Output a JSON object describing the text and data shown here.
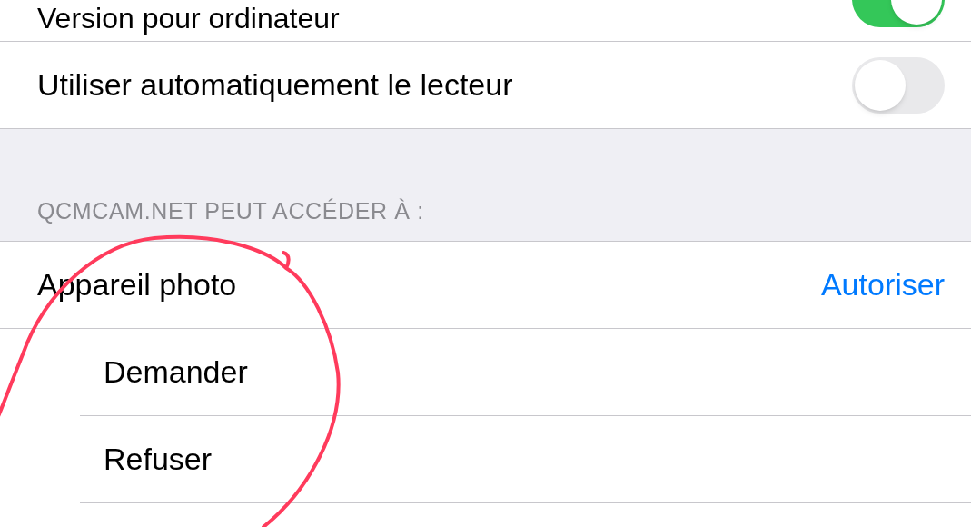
{
  "toggles": [
    {
      "label": "Version pour ordinateur",
      "on": true
    },
    {
      "label": "Utiliser automatiquement le lecteur",
      "on": false
    }
  ],
  "section": {
    "header": "QCMCAM.NET PEUT ACCÉDER À :"
  },
  "permission": {
    "label": "Appareil photo",
    "value": "Autoriser"
  },
  "options": [
    {
      "label": "Demander"
    },
    {
      "label": "Refuser"
    }
  ]
}
